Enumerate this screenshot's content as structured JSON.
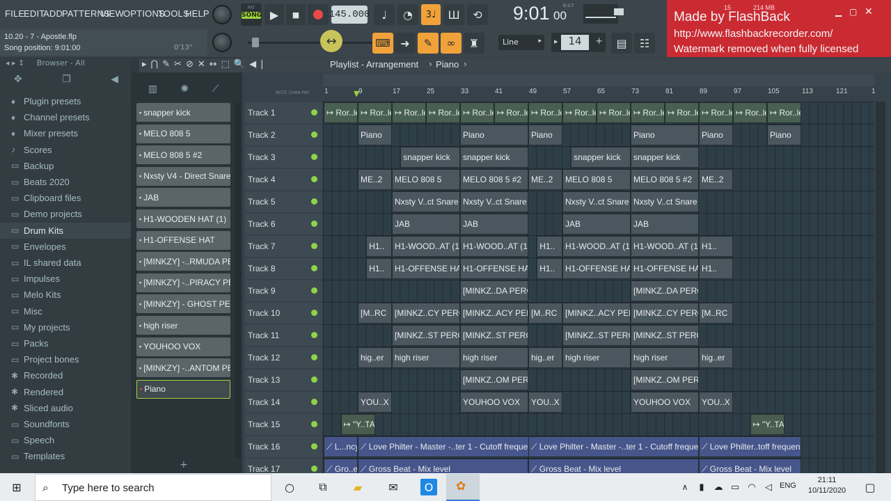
{
  "menu": [
    "FILE",
    "EDIT",
    "ADD",
    "PATTERNS",
    "VIEW",
    "OPTIONS",
    "TOOLS",
    "HELP"
  ],
  "transport": {
    "mode_pat": "PAT",
    "mode_song": "SONG",
    "tempo": "145.000",
    "time": "9:01",
    "time_frac": "00",
    "time_unit": "B:S:T",
    "cpu": "15",
    "mem": "214 MB",
    "snap": "Line",
    "step": "14"
  },
  "hint": {
    "file": "10.20 - 7 - Apostle.flp",
    "position": "Song position: 9:01:00",
    "time": "0'13\""
  },
  "watermark": {
    "line1": "Made by FlashBack",
    "line2": "http://www.flashbackrecorder.com/",
    "line3": "Watermark removed when fully licensed"
  },
  "browser": {
    "title": "Browser - All",
    "items": [
      {
        "label": "Plugin presets",
        "icon": "♦"
      },
      {
        "label": "Channel presets",
        "icon": "♦"
      },
      {
        "label": "Mixer presets",
        "icon": "♦"
      },
      {
        "label": "Scores",
        "icon": "♪"
      },
      {
        "label": "Backup",
        "icon": "▭"
      },
      {
        "label": "Beats 2020",
        "icon": "▭"
      },
      {
        "label": "Clipboard files",
        "icon": "▭"
      },
      {
        "label": "Demo projects",
        "icon": "▭"
      },
      {
        "label": "Drum Kits",
        "icon": "▭"
      },
      {
        "label": "Envelopes",
        "icon": "▭"
      },
      {
        "label": "IL shared data",
        "icon": "▭"
      },
      {
        "label": "Impulses",
        "icon": "▭"
      },
      {
        "label": "Melo Kits",
        "icon": "▭"
      },
      {
        "label": "Misc",
        "icon": "▭"
      },
      {
        "label": "My projects",
        "icon": "▭"
      },
      {
        "label": "Packs",
        "icon": "▭"
      },
      {
        "label": "Project bones",
        "icon": "▭"
      },
      {
        "label": "Recorded",
        "icon": "✱"
      },
      {
        "label": "Rendered",
        "icon": "✱"
      },
      {
        "label": "Sliced audio",
        "icon": "✱"
      },
      {
        "label": "Soundfonts",
        "icon": "▭"
      },
      {
        "label": "Speech",
        "icon": "▭"
      },
      {
        "label": "Templates",
        "icon": "▭"
      }
    ]
  },
  "channels": [
    "snapper kick",
    "MELO 808 5",
    "MELO 808 5 #2",
    "Nxsty V4 - Direct Snare",
    "JAB",
    "H1-WOODEN HAT (1)",
    "H1-OFFENSE HAT",
    "[MINKZY] -..RMUDA PERC",
    "[MINKZY] -..PIRACY PERC",
    "[MINKZY] - GHOST PERC",
    "high riser",
    "YOUHOO VOX",
    "[MINKZY] -..ANTOM PERC",
    "Piano"
  ],
  "playlist": {
    "title": "Playlist - Arrangement",
    "pattern": "Piano",
    "ruler": [
      "1",
      "9",
      "17",
      "25",
      "33",
      "41",
      "49",
      "57",
      "65",
      "73",
      "81",
      "89",
      "97",
      "105",
      "113",
      "121",
      "1"
    ],
    "tracks": [
      "Track 1",
      "Track 2",
      "Track 3",
      "Track 4",
      "Track 5",
      "Track 6",
      "Track 7",
      "Track 8",
      "Track 9",
      "Track 10",
      "Track 11",
      "Track 12",
      "Track 13",
      "Track 14",
      "Track 15",
      "Track 16",
      "Track 17"
    ]
  },
  "clips": [
    {
      "t": 0,
      "s": 0,
      "w": 4,
      "l": "↦ Ror..le",
      "k": "c1"
    },
    {
      "t": 0,
      "s": 4,
      "w": 4,
      "l": "↦ Ror..le",
      "k": "c1"
    },
    {
      "t": 0,
      "s": 8,
      "w": 4,
      "l": "↦ Ror..le",
      "k": "c1"
    },
    {
      "t": 0,
      "s": 12,
      "w": 4,
      "l": "↦ Ror..le",
      "k": "c1"
    },
    {
      "t": 0,
      "s": 16,
      "w": 4,
      "l": "↦ Ror..le",
      "k": "c1"
    },
    {
      "t": 0,
      "s": 20,
      "w": 4,
      "l": "↦ Ror..le",
      "k": "c1"
    },
    {
      "t": 0,
      "s": 24,
      "w": 4,
      "l": "↦ Ror..le",
      "k": "c1"
    },
    {
      "t": 0,
      "s": 28,
      "w": 4,
      "l": "↦ Ror..le",
      "k": "c1"
    },
    {
      "t": 0,
      "s": 32,
      "w": 4,
      "l": "↦ Ror..le",
      "k": "c1"
    },
    {
      "t": 0,
      "s": 36,
      "w": 4,
      "l": "↦ Ror..le",
      "k": "c1"
    },
    {
      "t": 0,
      "s": 40,
      "w": 4,
      "l": "↦ Ror..le",
      "k": "c1"
    },
    {
      "t": 0,
      "s": 44,
      "w": 4,
      "l": "↦ Ror..le",
      "k": "c1"
    },
    {
      "t": 0,
      "s": 48,
      "w": 4,
      "l": "↦ Ror..le",
      "k": "c1"
    },
    {
      "t": 0,
      "s": 52,
      "w": 4,
      "l": "↦ Ror..le",
      "k": "c1"
    },
    {
      "t": 1,
      "s": 4,
      "w": 4,
      "l": "Piano"
    },
    {
      "t": 1,
      "s": 16,
      "w": 8,
      "l": "Piano"
    },
    {
      "t": 1,
      "s": 24,
      "w": 4,
      "l": "Piano"
    },
    {
      "t": 1,
      "s": 36,
      "w": 8,
      "l": "Piano"
    },
    {
      "t": 1,
      "s": 44,
      "w": 4,
      "l": "Piano"
    },
    {
      "t": 1,
      "s": 52,
      "w": 4,
      "l": "Piano"
    },
    {
      "t": 2,
      "s": 9,
      "w": 7,
      "l": "snapper kick"
    },
    {
      "t": 2,
      "s": 16,
      "w": 8,
      "l": "snapper kick"
    },
    {
      "t": 2,
      "s": 29,
      "w": 7,
      "l": "snapper kick"
    },
    {
      "t": 2,
      "s": 36,
      "w": 8,
      "l": "snapper kick"
    },
    {
      "t": 3,
      "s": 4,
      "w": 4,
      "l": "ME..2"
    },
    {
      "t": 3,
      "s": 8,
      "w": 8,
      "l": "MELO 808 5"
    },
    {
      "t": 3,
      "s": 16,
      "w": 8,
      "l": "MELO 808 5 #2"
    },
    {
      "t": 3,
      "s": 24,
      "w": 4,
      "l": "ME..2"
    },
    {
      "t": 3,
      "s": 28,
      "w": 8,
      "l": "MELO 808 5"
    },
    {
      "t": 3,
      "s": 36,
      "w": 8,
      "l": "MELO 808 5 #2"
    },
    {
      "t": 3,
      "s": 44,
      "w": 4,
      "l": "ME..2"
    },
    {
      "t": 4,
      "s": 8,
      "w": 8,
      "l": "Nxsty V..ct Snare"
    },
    {
      "t": 4,
      "s": 16,
      "w": 8,
      "l": "Nxsty V..ct Snare"
    },
    {
      "t": 4,
      "s": 28,
      "w": 8,
      "l": "Nxsty V..ct Snare"
    },
    {
      "t": 4,
      "s": 36,
      "w": 8,
      "l": "Nxsty V..ct Snare"
    },
    {
      "t": 5,
      "s": 8,
      "w": 8,
      "l": "JAB"
    },
    {
      "t": 5,
      "s": 16,
      "w": 8,
      "l": "JAB"
    },
    {
      "t": 5,
      "s": 28,
      "w": 8,
      "l": "JAB"
    },
    {
      "t": 5,
      "s": 36,
      "w": 8,
      "l": "JAB"
    },
    {
      "t": 6,
      "s": 5,
      "w": 3,
      "l": "H1.."
    },
    {
      "t": 6,
      "s": 8,
      "w": 8,
      "l": "H1-WOOD..AT (1)"
    },
    {
      "t": 6,
      "s": 16,
      "w": 8,
      "l": "H1-WOOD..AT (1)"
    },
    {
      "t": 6,
      "s": 25,
      "w": 3,
      "l": "H1.."
    },
    {
      "t": 6,
      "s": 28,
      "w": 8,
      "l": "H1-WOOD..AT (1)"
    },
    {
      "t": 6,
      "s": 36,
      "w": 8,
      "l": "H1-WOOD..AT (1)"
    },
    {
      "t": 6,
      "s": 44,
      "w": 4,
      "l": "H1.."
    },
    {
      "t": 7,
      "s": 5,
      "w": 3,
      "l": "H1.."
    },
    {
      "t": 7,
      "s": 8,
      "w": 8,
      "l": "H1-OFFENSE HAT"
    },
    {
      "t": 7,
      "s": 16,
      "w": 8,
      "l": "H1-OFFENSE HAT"
    },
    {
      "t": 7,
      "s": 25,
      "w": 3,
      "l": "H1.."
    },
    {
      "t": 7,
      "s": 28,
      "w": 8,
      "l": "H1-OFFENSE HAT"
    },
    {
      "t": 7,
      "s": 36,
      "w": 8,
      "l": "H1-OFFENSE HAT"
    },
    {
      "t": 7,
      "s": 44,
      "w": 4,
      "l": "H1.."
    },
    {
      "t": 8,
      "s": 16,
      "w": 8,
      "l": "[MINKZ..DA PERC"
    },
    {
      "t": 8,
      "s": 36,
      "w": 8,
      "l": "[MINKZ..DA PERC"
    },
    {
      "t": 9,
      "s": 4,
      "w": 4,
      "l": "[M..RC"
    },
    {
      "t": 9,
      "s": 8,
      "w": 8,
      "l": "[MINKZ..CY PERC"
    },
    {
      "t": 9,
      "s": 16,
      "w": 8,
      "l": "[MINKZ..ACY PERC"
    },
    {
      "t": 9,
      "s": 24,
      "w": 4,
      "l": "[M..RC"
    },
    {
      "t": 9,
      "s": 28,
      "w": 8,
      "l": "[MINKZ..ACY PERC"
    },
    {
      "t": 9,
      "s": 36,
      "w": 8,
      "l": "[MINKZ..CY PERC"
    },
    {
      "t": 9,
      "s": 44,
      "w": 4,
      "l": "[M..RC"
    },
    {
      "t": 10,
      "s": 8,
      "w": 8,
      "l": "[MINKZ..ST PERC"
    },
    {
      "t": 10,
      "s": 16,
      "w": 8,
      "l": "[MINKZ..ST PERC"
    },
    {
      "t": 10,
      "s": 28,
      "w": 8,
      "l": "[MINKZ..ST PERC"
    },
    {
      "t": 10,
      "s": 36,
      "w": 8,
      "l": "[MINKZ..ST PERC"
    },
    {
      "t": 11,
      "s": 4,
      "w": 4,
      "l": "hig..er"
    },
    {
      "t": 11,
      "s": 8,
      "w": 8,
      "l": "high riser"
    },
    {
      "t": 11,
      "s": 16,
      "w": 8,
      "l": "high riser"
    },
    {
      "t": 11,
      "s": 24,
      "w": 4,
      "l": "hig..er"
    },
    {
      "t": 11,
      "s": 28,
      "w": 8,
      "l": "high riser"
    },
    {
      "t": 11,
      "s": 36,
      "w": 8,
      "l": "high riser"
    },
    {
      "t": 11,
      "s": 44,
      "w": 4,
      "l": "hig..er"
    },
    {
      "t": 12,
      "s": 16,
      "w": 8,
      "l": "[MINKZ..OM PERC"
    },
    {
      "t": 12,
      "s": 36,
      "w": 8,
      "l": "[MINKZ..OM PERC"
    },
    {
      "t": 13,
      "s": 4,
      "w": 4,
      "l": "YOU..X"
    },
    {
      "t": 13,
      "s": 16,
      "w": 8,
      "l": "YOUHOO VOX"
    },
    {
      "t": 13,
      "s": 24,
      "w": 4,
      "l": "YOU..X"
    },
    {
      "t": 13,
      "s": 36,
      "w": 8,
      "l": "YOUHOO VOX"
    },
    {
      "t": 13,
      "s": 44,
      "w": 4,
      "l": "YOU..X"
    },
    {
      "t": 14,
      "s": 2,
      "w": 4,
      "l": "↦ \"Y..TAG",
      "k": "c15"
    },
    {
      "t": 14,
      "s": 50,
      "w": 4,
      "l": "↦ \"Y..TAG",
      "k": "c15"
    },
    {
      "t": 15,
      "s": 0,
      "w": 4,
      "l": "⟋ L...ncy",
      "k": "auto"
    },
    {
      "t": 15,
      "s": 4,
      "w": 24,
      "l": "⟋ Love Philter - Master -..ter 1 - Cutoff frequency",
      "k": "auto"
    },
    {
      "t": 15,
      "s": 24,
      "w": 20,
      "l": "⟋ Love Philter - Master -..ter 1 - Cutoff frequency",
      "k": "auto"
    },
    {
      "t": 15,
      "s": 44,
      "w": 12,
      "l": "⟋ Love Philter..toff frequency",
      "k": "auto"
    },
    {
      "t": 16,
      "s": 0,
      "w": 4,
      "l": "⟋ Gro..el",
      "k": "auto"
    },
    {
      "t": 16,
      "s": 4,
      "w": 20,
      "l": "⟋ Gross Beat - Mix level",
      "k": "auto"
    },
    {
      "t": 16,
      "s": 24,
      "w": 20,
      "l": "⟋ Gross Beat - Mix level",
      "k": "auto"
    },
    {
      "t": 16,
      "s": 44,
      "w": 12,
      "l": "⟋ Gross Beat - Mix level",
      "k": "auto"
    }
  ],
  "taskbar": {
    "search_placeholder": "Type here to search",
    "time": "21:11",
    "date": "10/11/2020",
    "lang": "ENG"
  }
}
